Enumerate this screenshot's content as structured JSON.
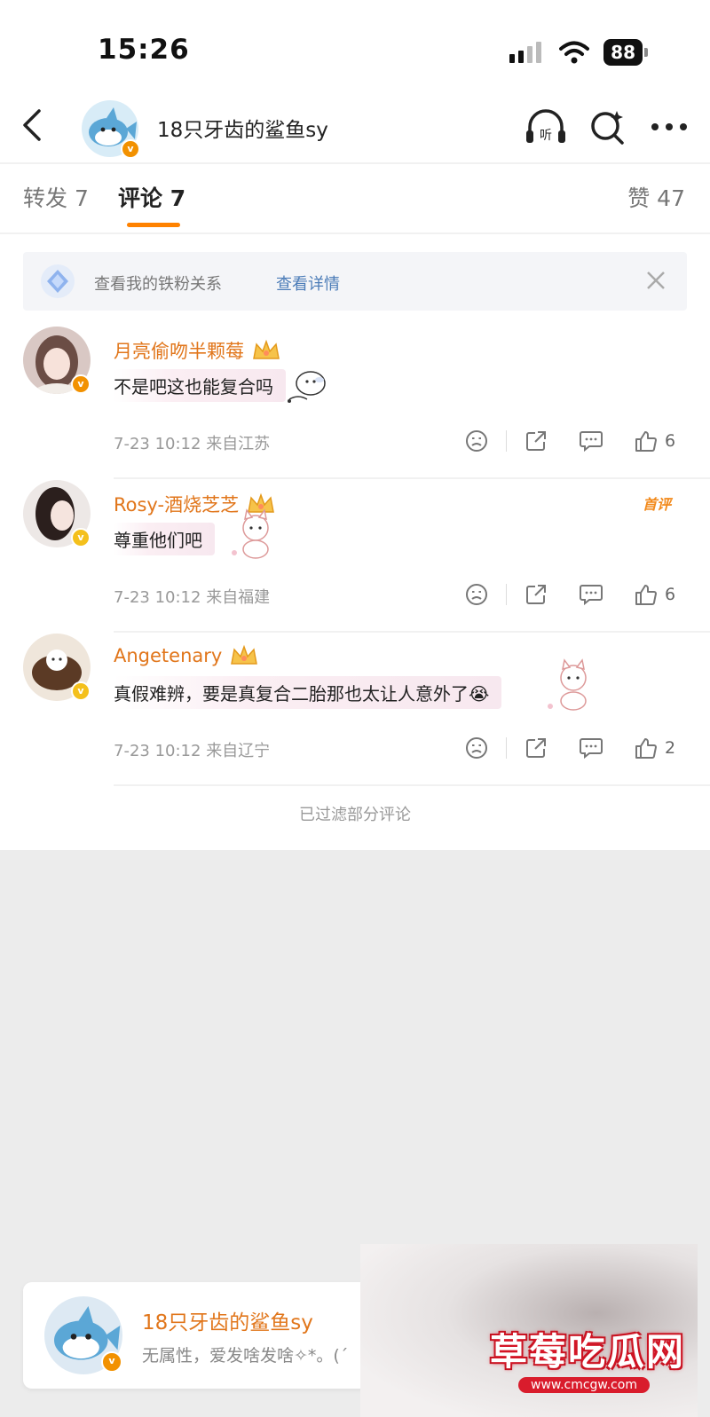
{
  "status_bar": {
    "time": "15:26",
    "battery": "88"
  },
  "header": {
    "title": "18只牙齿的鲨鱼sy",
    "listen_label": "听"
  },
  "tabs": [
    {
      "label": "转发 7"
    },
    {
      "label": "评论 7"
    },
    {
      "label": "赞 47"
    }
  ],
  "fan_banner": {
    "text": "查看我的铁粉关系",
    "link": "查看详情"
  },
  "comments": [
    {
      "user": "月亮偷吻半颗莓",
      "text": "不是吧这也能复合吗",
      "time": "7-23 10:12",
      "location": "来自江苏",
      "likes": "6",
      "badge": ""
    },
    {
      "user": "Rosy-酒烧芝芝",
      "text": "尊重他们吧",
      "time": "7-23 10:12",
      "location": "来自福建",
      "likes": "6",
      "badge": "首评"
    },
    {
      "user": "Angetenary",
      "text": "真假难辨，要是真复合二胎那也太让人意外了😭",
      "time": "7-23 10:12",
      "location": "来自辽宁",
      "likes": "2",
      "badge": ""
    }
  ],
  "filtered_notice": "已过滤部分评论",
  "bottom_card": {
    "name": "18只牙齿的鲨鱼sy",
    "bio": "无属性，爱发啥发啥✧*。(ˊ"
  },
  "watermark": {
    "title": "草莓吃瓜网",
    "url": "www.cmcgw.com"
  },
  "colors": {
    "accent": "#ff8200",
    "username": "#e1761b",
    "link": "#4d7db8"
  }
}
